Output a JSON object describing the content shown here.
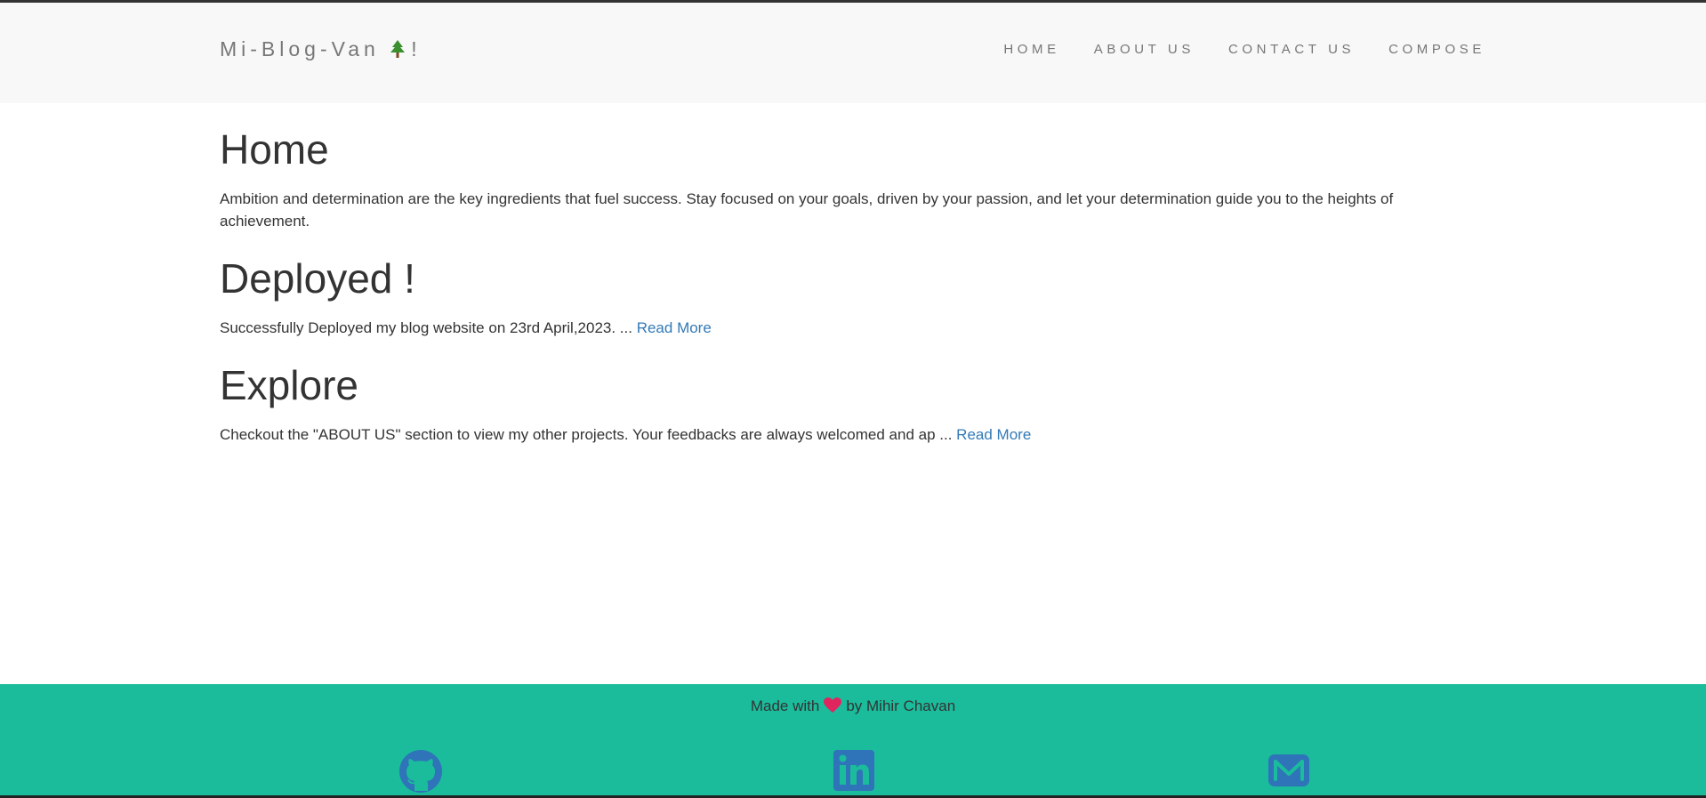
{
  "navbar": {
    "brand": "Mi-Blog-Van",
    "brand_suffix": "!",
    "links": [
      "HOME",
      "ABOUT US",
      "CONTACT US",
      "COMPOSE"
    ]
  },
  "posts": [
    {
      "title": "Home",
      "body": "Ambition and determination are the key ingredients that fuel success. Stay focused on your goals, driven by your passion, and let your determination guide you to the heights of achievement.",
      "link": ""
    },
    {
      "title": "Deployed !",
      "body": "Successfully Deployed my blog website on 23rd April,2023. ... ",
      "link": "Read More"
    },
    {
      "title": "Explore",
      "body": "Checkout the \"ABOUT US\" section to view my other projects. Your feedbacks are always welcomed and ap ... ",
      "link": "Read More"
    }
  ],
  "footer": {
    "made_with": "Made with",
    "by": "by Mihir Chavan",
    "icons": [
      "github-icon",
      "linkedin-icon",
      "mail-icon"
    ]
  },
  "colors": {
    "navbar_bg": "#f8f8f8",
    "footer_bg": "#1abc9c",
    "link": "#337ab7",
    "nav_text": "#777777",
    "icon": "#2f73b8",
    "heart": "#e0245e"
  }
}
